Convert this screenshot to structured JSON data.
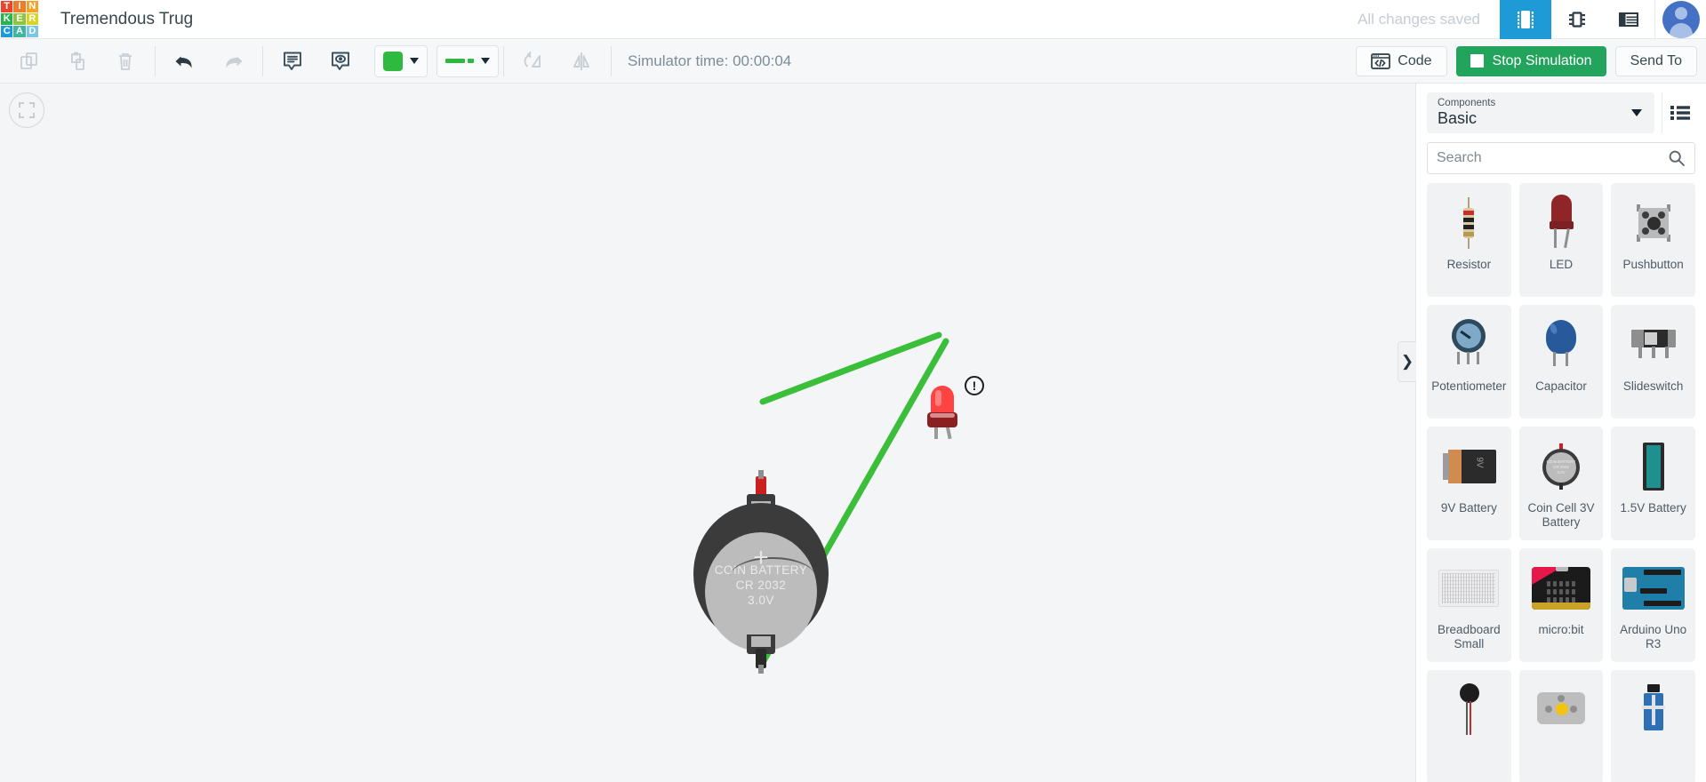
{
  "app": {
    "logo_letters": [
      "T",
      "I",
      "N",
      "K",
      "E",
      "R",
      "C",
      "A",
      "D"
    ],
    "logo_colors": [
      "#e8452c",
      "#f07c2a",
      "#f2a32b",
      "#2bb24c",
      "#8cc63e",
      "#d9d423",
      "#1e9ad6",
      "#3eb6a0",
      "#79c7e8"
    ],
    "doc_title": "Tremendous Trug",
    "save_status": "All changes saved"
  },
  "topbar_icons": [
    {
      "name": "breadboard-view-icon",
      "active": true
    },
    {
      "name": "schematic-view-icon",
      "active": false
    },
    {
      "name": "components-list-icon",
      "active": false
    }
  ],
  "toolbar": {
    "copy_label": "Copy",
    "paste_label": "Paste",
    "delete_label": "Delete",
    "undo_label": "Undo",
    "redo_label": "Redo",
    "annotation_label": "Annotation",
    "highlight_label": "Highlight",
    "wire_color": "#2dba3f",
    "wire_color_label": "Wire Color",
    "wire_style_label": "Wire Style",
    "rotate_label": "Rotate",
    "mirror_label": "Mirror",
    "simulator_time": "Simulator time: 00:00:04",
    "code_label": "Code",
    "stop_simulation_label": "Stop Simulation",
    "send_to_label": "Send To",
    "stop_button_color": "#22a45d"
  },
  "canvas": {
    "fit_view_label": "Zoom to fit",
    "wire_color": "#3bbf3b",
    "battery": {
      "line1": "COIN BATTERY",
      "line2": "CR 2032",
      "line3": "3.0V",
      "polarity_mark": "+"
    },
    "led": {
      "warning_badge": "!",
      "state": "lit",
      "color": "#ff4343"
    }
  },
  "panel": {
    "dropdown_label": "Components",
    "dropdown_value": "Basic",
    "list_view_label": "List view",
    "search_placeholder": "Search",
    "search_value": "",
    "collapse_label": "❯",
    "components": [
      {
        "label": "Resistor",
        "art": "resistor"
      },
      {
        "label": "LED",
        "art": "led"
      },
      {
        "label": "Pushbutton",
        "art": "pushbutton"
      },
      {
        "label": "Potentiometer",
        "art": "potentiometer"
      },
      {
        "label": "Capacitor",
        "art": "capacitor"
      },
      {
        "label": "Slideswitch",
        "art": "slideswitch"
      },
      {
        "label": "9V Battery",
        "art": "battery9v"
      },
      {
        "label": "Coin Cell 3V Battery",
        "art": "coincell"
      },
      {
        "label": "1.5V Battery",
        "art": "battery15v"
      },
      {
        "label": "Breadboard Small",
        "art": "breadboard"
      },
      {
        "label": "micro:bit",
        "art": "microbit"
      },
      {
        "label": "Arduino Uno R3",
        "art": "arduino"
      },
      {
        "label": "",
        "art": "vibration"
      },
      {
        "label": "",
        "art": "dcmotor"
      },
      {
        "label": "",
        "art": "servo"
      }
    ]
  }
}
